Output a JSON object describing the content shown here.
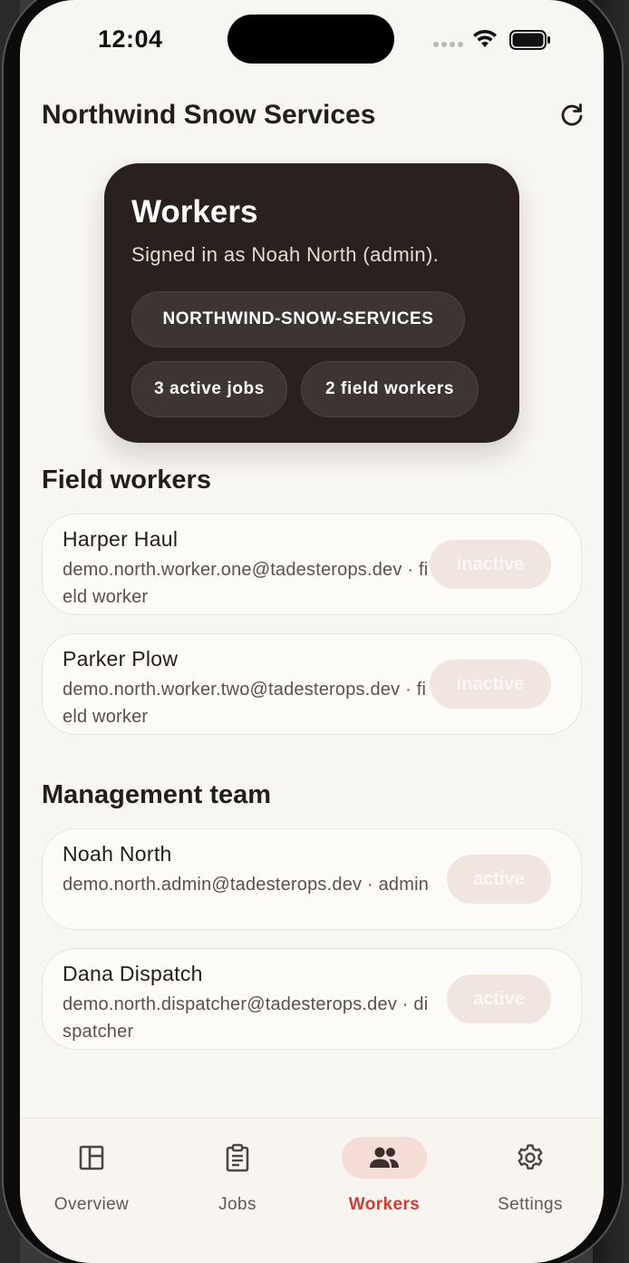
{
  "status_bar": {
    "time": "12:04"
  },
  "header": {
    "title": "Northwind Snow Services",
    "refresh_icon": "refresh-icon"
  },
  "hero": {
    "title": "Workers",
    "subtitle": "Signed in as Noah North (admin).",
    "org_slug": "NORTHWIND-SNOW-SERVICES",
    "active_jobs": "3 active jobs",
    "field_workers": "2 field workers"
  },
  "field_workers": {
    "title": "Field workers",
    "items": [
      {
        "name": "Harper Haul",
        "detail": "demo.north.worker.one@tadesterops.dev · field worker",
        "status": "inactive"
      },
      {
        "name": "Parker Plow",
        "detail": "demo.north.worker.two@tadesterops.dev · field worker",
        "status": "inactive"
      }
    ]
  },
  "management": {
    "title": "Management team",
    "items": [
      {
        "name": "Noah North",
        "detail": "demo.north.admin@tadesterops.dev · admin",
        "status": "active"
      },
      {
        "name": "Dana Dispatch",
        "detail": "demo.north.dispatcher@tadesterops.dev · dispatcher",
        "status": "active"
      }
    ]
  },
  "nav": {
    "items": [
      {
        "label": "Overview",
        "icon": "dashboard-icon"
      },
      {
        "label": "Jobs",
        "icon": "clipboard-icon"
      },
      {
        "label": "Workers",
        "icon": "people-icon",
        "active": true
      },
      {
        "label": "Settings",
        "icon": "gear-icon"
      }
    ]
  },
  "colors": {
    "accent": "#d23c32",
    "hero_bg": "#2a201d",
    "page_bg": "#f8f6f2"
  }
}
